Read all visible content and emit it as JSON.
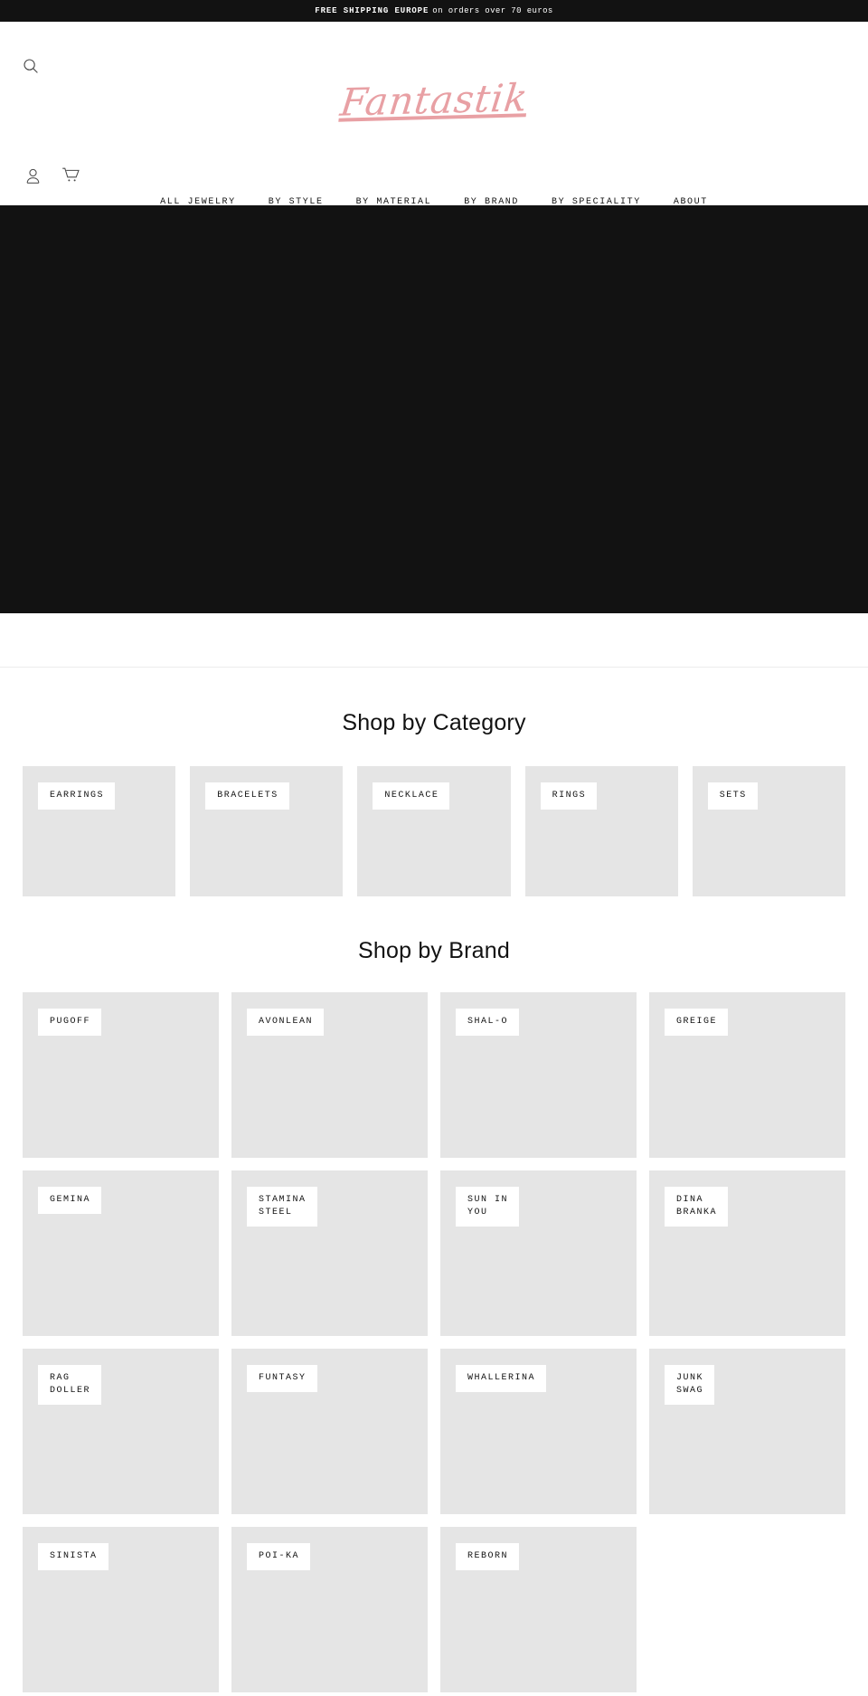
{
  "announcement": {
    "bold_text": "FREE SHIPPING EUROPE",
    "rest_text": "on orders over 70 euros"
  },
  "header": {
    "logo_text": "Fantastik",
    "search_icon": "search-icon",
    "account_icon": "account-person-icon",
    "cart_icon": "shopping-cart-icon",
    "nav": [
      {
        "label": "ALL JEWELRY"
      },
      {
        "label": "BY STYLE"
      },
      {
        "label": "BY MATERIAL"
      },
      {
        "label": "BY BRAND"
      },
      {
        "label": "BY SPECIALITY"
      },
      {
        "label": "ABOUT"
      }
    ]
  },
  "hero": {
    "background_color": "#121212"
  },
  "category_section": {
    "title": "Shop by Category",
    "tiles": [
      {
        "label": "EARRINGS"
      },
      {
        "label": "BRACELETS"
      },
      {
        "label": "NECKLACE"
      },
      {
        "label": "RINGS"
      },
      {
        "label": "SETS"
      }
    ]
  },
  "brand_section": {
    "title": "Shop by Brand",
    "tiles": [
      {
        "label": "PUGOFF"
      },
      {
        "label": "AVONLEAN"
      },
      {
        "label": "SHAL-O"
      },
      {
        "label": "GREIGE"
      },
      {
        "label": "GEMINA"
      },
      {
        "label": "STAMINA\nSTEEL"
      },
      {
        "label": "SUN IN\nYOU"
      },
      {
        "label": "DINA\nBRANKA"
      },
      {
        "label": "RAG\nDOLLER"
      },
      {
        "label": "FUNTASY"
      },
      {
        "label": "WHALLERINA"
      },
      {
        "label": "JUNK\nSWAG"
      },
      {
        "label": "SINISTA"
      },
      {
        "label": "POI-KA"
      },
      {
        "label": "REBORN"
      }
    ]
  },
  "colors": {
    "brand_pink": "#e8a0a4",
    "dark": "#121212",
    "tile_gray": "#e5e5e5"
  }
}
